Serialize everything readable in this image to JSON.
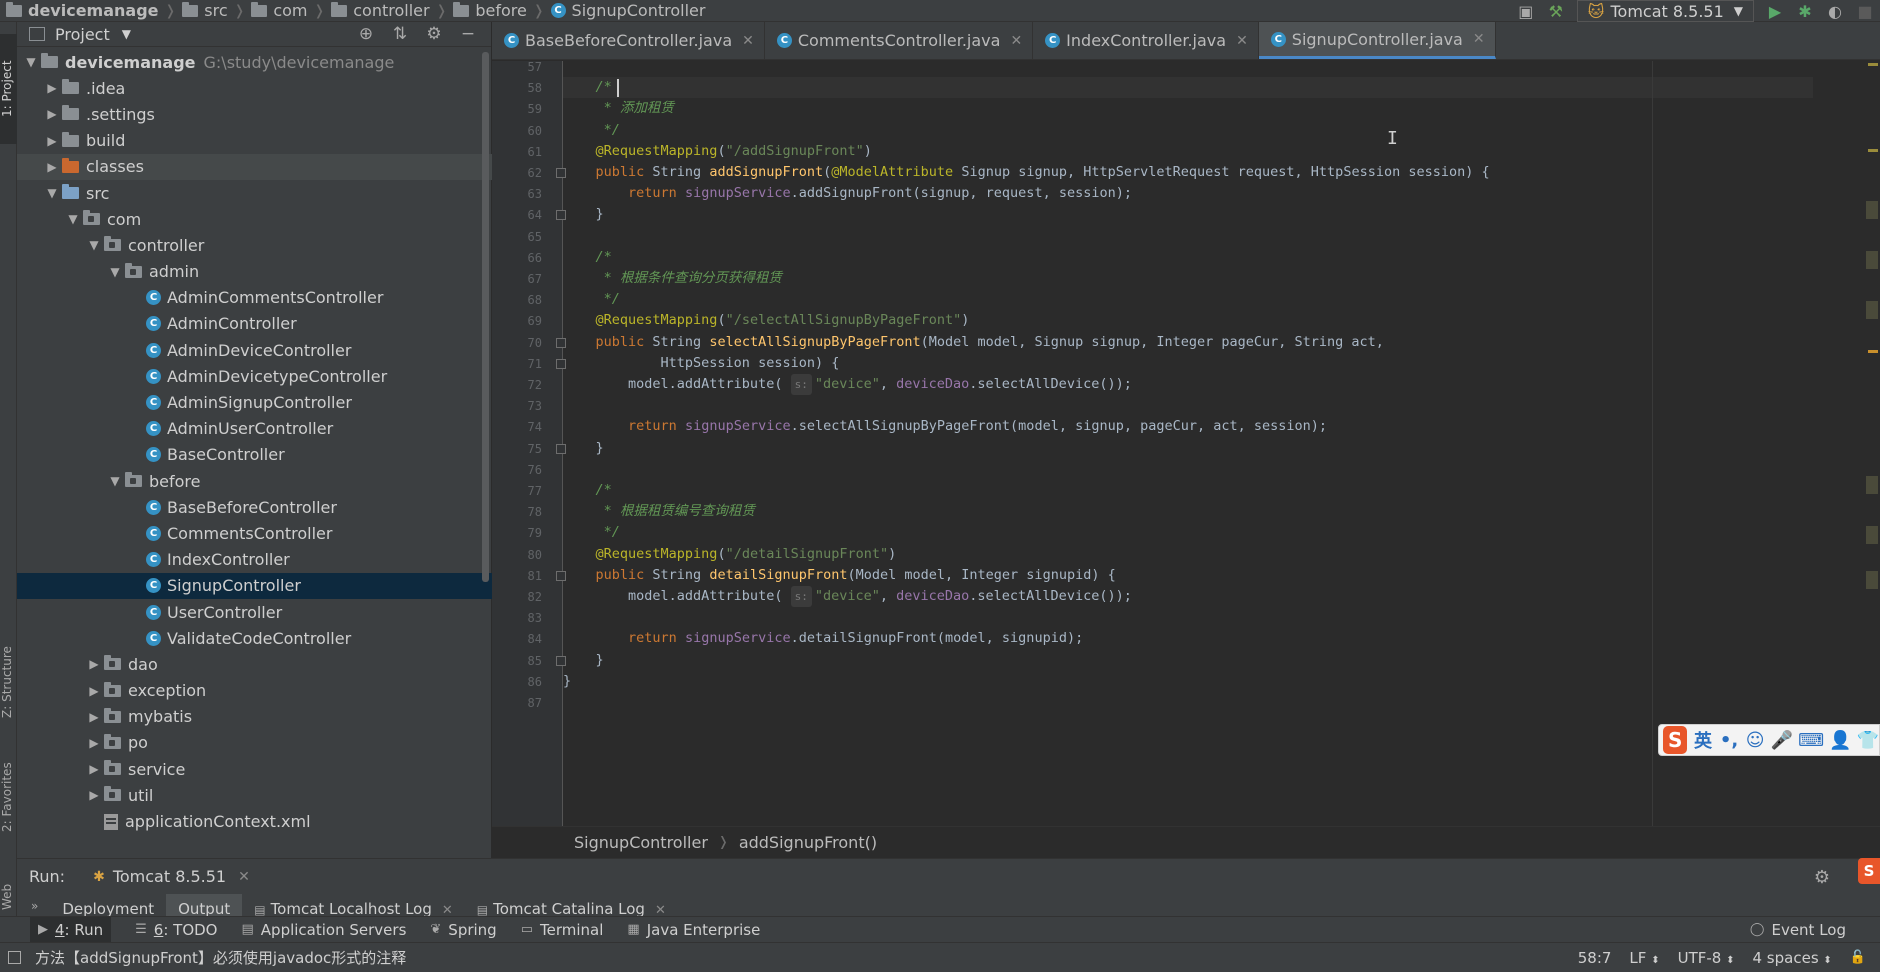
{
  "navbar": {
    "crumbs": [
      "devicemanage",
      "src",
      "com",
      "controller",
      "before",
      "SignupController"
    ]
  },
  "toolbar": {
    "run_config": "Tomcat 8.5.51"
  },
  "left_stripe": {
    "project": "1: Project",
    "structure": "Z: Structure",
    "favorites": "2: Favorites",
    "web": "Web"
  },
  "project_panel": {
    "title": "Project",
    "tree": [
      {
        "depth": 0,
        "type": "root",
        "label": "devicemanage",
        "path": "G:\\study\\devicemanage",
        "expanded": true
      },
      {
        "depth": 1,
        "type": "folder",
        "label": ".idea",
        "expanded": false
      },
      {
        "depth": 1,
        "type": "folder",
        "label": ".settings",
        "expanded": false
      },
      {
        "depth": 1,
        "type": "folder",
        "label": "build",
        "expanded": false
      },
      {
        "depth": 1,
        "type": "folder-orange",
        "label": "classes",
        "expanded": false,
        "highlight": true
      },
      {
        "depth": 1,
        "type": "folder-blue",
        "label": "src",
        "expanded": true
      },
      {
        "depth": 2,
        "type": "package",
        "label": "com",
        "expanded": true
      },
      {
        "depth": 3,
        "type": "package",
        "label": "controller",
        "expanded": true
      },
      {
        "depth": 4,
        "type": "package",
        "label": "admin",
        "expanded": true
      },
      {
        "depth": 5,
        "type": "class",
        "label": "AdminCommentsController"
      },
      {
        "depth": 5,
        "type": "class",
        "label": "AdminController"
      },
      {
        "depth": 5,
        "type": "class",
        "label": "AdminDeviceController"
      },
      {
        "depth": 5,
        "type": "class",
        "label": "AdminDevicetypeController"
      },
      {
        "depth": 5,
        "type": "class",
        "label": "AdminSignupController"
      },
      {
        "depth": 5,
        "type": "class",
        "label": "AdminUserController"
      },
      {
        "depth": 5,
        "type": "class",
        "label": "BaseController"
      },
      {
        "depth": 4,
        "type": "package",
        "label": "before",
        "expanded": true
      },
      {
        "depth": 5,
        "type": "class",
        "label": "BaseBeforeController"
      },
      {
        "depth": 5,
        "type": "class",
        "label": "CommentsController"
      },
      {
        "depth": 5,
        "type": "class",
        "label": "IndexController"
      },
      {
        "depth": 5,
        "type": "class",
        "label": "SignupController",
        "selected": true
      },
      {
        "depth": 5,
        "type": "class",
        "label": "UserController"
      },
      {
        "depth": 5,
        "type": "class",
        "label": "ValidateCodeController"
      },
      {
        "depth": 3,
        "type": "package",
        "label": "dao",
        "expanded": false
      },
      {
        "depth": 3,
        "type": "package",
        "label": "exception",
        "expanded": false
      },
      {
        "depth": 3,
        "type": "package",
        "label": "mybatis",
        "expanded": false
      },
      {
        "depth": 3,
        "type": "package",
        "label": "po",
        "expanded": false
      },
      {
        "depth": 3,
        "type": "package",
        "label": "service",
        "expanded": false
      },
      {
        "depth": 3,
        "type": "package",
        "label": "util",
        "expanded": false
      },
      {
        "depth": 3,
        "type": "xml",
        "label": "applicationContext.xml"
      }
    ]
  },
  "editor": {
    "tabs": [
      {
        "label": "BaseBeforeController.java",
        "active": false
      },
      {
        "label": "CommentsController.java",
        "active": false
      },
      {
        "label": "IndexController.java",
        "active": false
      },
      {
        "label": "SignupController.java",
        "active": true
      }
    ],
    "lines": [
      {
        "n": 57,
        "tokens": []
      },
      {
        "n": 58,
        "current": true,
        "tokens": [
          [
            "t",
            "    "
          ],
          [
            "cmt",
            "/*"
          ]
        ]
      },
      {
        "n": 59,
        "tokens": [
          [
            "t",
            "     "
          ],
          [
            "cmt",
            "* 添加租赁"
          ]
        ]
      },
      {
        "n": 60,
        "tokens": [
          [
            "t",
            "     "
          ],
          [
            "cmt",
            "*/"
          ]
        ]
      },
      {
        "n": 61,
        "tokens": [
          [
            "t",
            "    "
          ],
          [
            "ann",
            "@RequestMapping"
          ],
          [
            "t",
            "("
          ],
          [
            "str",
            "\"/addSignupFront\""
          ],
          [
            "t",
            ")"
          ]
        ]
      },
      {
        "n": 62,
        "fold": true,
        "tokens": [
          [
            "t",
            "    "
          ],
          [
            "kw",
            "public "
          ],
          [
            "t",
            "String "
          ],
          [
            "fn",
            "addSignupFront"
          ],
          [
            "t",
            "("
          ],
          [
            "ann",
            "@ModelAttribute "
          ],
          [
            "t",
            "Signup signup, HttpServletRequest request, HttpSession session) {"
          ]
        ]
      },
      {
        "n": 63,
        "tokens": [
          [
            "t",
            "        "
          ],
          [
            "kw",
            "return "
          ],
          [
            "fld",
            "signupService"
          ],
          [
            "t",
            ".addSignupFront(signup, request, session);"
          ]
        ]
      },
      {
        "n": 64,
        "fold": true,
        "tokens": [
          [
            "t",
            "    }"
          ]
        ]
      },
      {
        "n": 65,
        "tokens": []
      },
      {
        "n": 66,
        "tokens": [
          [
            "t",
            "    "
          ],
          [
            "cmt",
            "/*"
          ]
        ]
      },
      {
        "n": 67,
        "tokens": [
          [
            "t",
            "     "
          ],
          [
            "cmt",
            "* 根据条件查询分页获得租赁"
          ]
        ]
      },
      {
        "n": 68,
        "tokens": [
          [
            "t",
            "     "
          ],
          [
            "cmt",
            "*/"
          ]
        ]
      },
      {
        "n": 69,
        "tokens": [
          [
            "t",
            "    "
          ],
          [
            "ann",
            "@RequestMapping"
          ],
          [
            "t",
            "("
          ],
          [
            "str",
            "\"/selectAllSignupByPageFront\""
          ],
          [
            "t",
            ")"
          ]
        ]
      },
      {
        "n": 70,
        "fold": true,
        "tokens": [
          [
            "t",
            "    "
          ],
          [
            "kw",
            "public "
          ],
          [
            "t",
            "String "
          ],
          [
            "fn",
            "selectAllSignupByPageFront"
          ],
          [
            "t",
            "(Model model, Signup signup, Integer pageCur, String act,"
          ]
        ]
      },
      {
        "n": 71,
        "fold": true,
        "tokens": [
          [
            "t",
            "            HttpSession session) {"
          ]
        ]
      },
      {
        "n": 72,
        "tokens": [
          [
            "t",
            "        model.addAttribute( "
          ],
          [
            "hint",
            "s:"
          ],
          [
            "str",
            "\"device\""
          ],
          [
            "t",
            ", "
          ],
          [
            "fld",
            "deviceDao"
          ],
          [
            "t",
            ".selectAllDevice());"
          ]
        ]
      },
      {
        "n": 73,
        "tokens": []
      },
      {
        "n": 74,
        "tokens": [
          [
            "t",
            "        "
          ],
          [
            "kw",
            "return "
          ],
          [
            "fld",
            "signupService"
          ],
          [
            "t",
            ".selectAllSignupByPageFront(model, signup, pageCur, act, session);"
          ]
        ]
      },
      {
        "n": 75,
        "fold": true,
        "tokens": [
          [
            "t",
            "    }"
          ]
        ]
      },
      {
        "n": 76,
        "tokens": []
      },
      {
        "n": 77,
        "tokens": [
          [
            "t",
            "    "
          ],
          [
            "cmt",
            "/*"
          ]
        ]
      },
      {
        "n": 78,
        "tokens": [
          [
            "t",
            "     "
          ],
          [
            "cmt",
            "* 根据租赁编号查询租赁"
          ]
        ]
      },
      {
        "n": 79,
        "tokens": [
          [
            "t",
            "     "
          ],
          [
            "cmt",
            "*/"
          ]
        ]
      },
      {
        "n": 80,
        "tokens": [
          [
            "t",
            "    "
          ],
          [
            "ann",
            "@RequestMapping"
          ],
          [
            "t",
            "("
          ],
          [
            "str",
            "\"/detailSignupFront\""
          ],
          [
            "t",
            ")"
          ]
        ]
      },
      {
        "n": 81,
        "fold": true,
        "tokens": [
          [
            "t",
            "    "
          ],
          [
            "kw",
            "public "
          ],
          [
            "t",
            "String "
          ],
          [
            "fn",
            "detailSignupFront"
          ],
          [
            "t",
            "(Model model, Integer signupid) {"
          ]
        ]
      },
      {
        "n": 82,
        "tokens": [
          [
            "t",
            "        model.addAttribute( "
          ],
          [
            "hint",
            "s:"
          ],
          [
            "str",
            "\"device\""
          ],
          [
            "t",
            ", "
          ],
          [
            "fld",
            "deviceDao"
          ],
          [
            "t",
            ".selectAllDevice());"
          ]
        ]
      },
      {
        "n": 83,
        "tokens": []
      },
      {
        "n": 84,
        "tokens": [
          [
            "t",
            "        "
          ],
          [
            "kw",
            "return "
          ],
          [
            "fld",
            "signupService"
          ],
          [
            "t",
            ".detailSignupFront(model, signupid);"
          ]
        ]
      },
      {
        "n": 85,
        "fold": true,
        "tokens": [
          [
            "t",
            "    }"
          ]
        ]
      },
      {
        "n": 86,
        "tokens": [
          [
            "t",
            "}"
          ]
        ]
      },
      {
        "n": 87,
        "tokens": []
      }
    ]
  },
  "editor_breadcrumb": {
    "class": "SignupController",
    "method": "addSignupFront()"
  },
  "run_panel": {
    "label": "Run:",
    "config": "Tomcat 8.5.51",
    "tabs": [
      "Deployment",
      "Output",
      "Tomcat Localhost Log",
      "Tomcat Catalina Log"
    ]
  },
  "tool_strip": {
    "items": [
      {
        "num": "4",
        "label": ": Run",
        "icon": "play-icon",
        "active": true
      },
      {
        "num": "6",
        "label": ": TODO",
        "icon": "todo-icon"
      },
      {
        "num": "",
        "label": "Application Servers",
        "icon": "server-icon"
      },
      {
        "num": "",
        "label": "Spring",
        "icon": "spring-icon"
      },
      {
        "num": "",
        "label": "Terminal",
        "icon": "terminal-icon"
      },
      {
        "num": "",
        "label": "Java Enterprise",
        "icon": "java-enterprise-icon"
      }
    ],
    "event_log": "Event Log"
  },
  "status_bar": {
    "message": "方法【addSignupFront】必须使用javadoc形式的注释",
    "position": "58:7",
    "line_sep": "LF",
    "encoding": "UTF-8",
    "indent": "4 spaces"
  },
  "ime": {
    "logo": "S",
    "mode": "英"
  },
  "colors": {
    "accent": "#4a88c7",
    "keyword": "#cc7832",
    "string": "#6a8759",
    "annotation": "#bbb529",
    "method": "#ffc66d",
    "field": "#9876aa",
    "comment": "#629755"
  }
}
